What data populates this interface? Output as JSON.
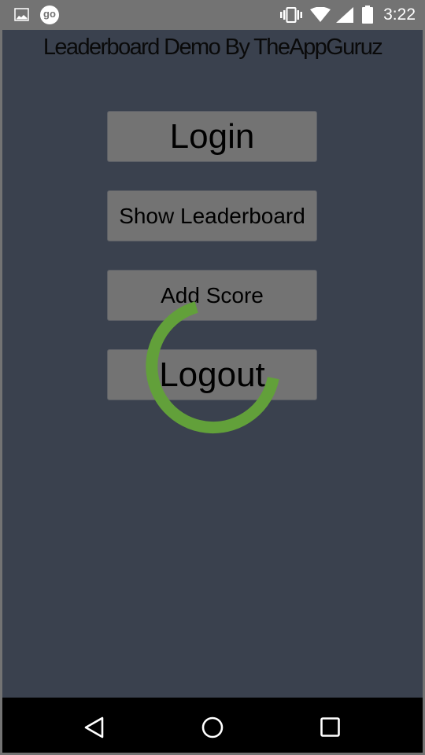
{
  "status_bar": {
    "left_icons": [
      "image-icon",
      "go-icon"
    ],
    "right_icons": [
      "vibrate-icon",
      "wifi-icon",
      "signal-icon",
      "battery-icon"
    ],
    "go_badge_text": "go",
    "time": "3:22"
  },
  "app": {
    "title": "Leaderboard Demo By TheAppGuruz",
    "buttons": [
      {
        "label": "Login"
      },
      {
        "label": "Show Leaderboard"
      },
      {
        "label": "Add Score"
      },
      {
        "label": "Logout"
      }
    ],
    "loading_spinner": {
      "visible": true,
      "color": "#62a03a"
    }
  },
  "nav_bar": {
    "buttons": [
      "back",
      "home",
      "recents"
    ]
  },
  "colors": {
    "app_background": "#3a414e",
    "button_background": "#737373",
    "status_bar": "#737373",
    "nav_bar": "#000000",
    "spinner": "#62a03a"
  }
}
